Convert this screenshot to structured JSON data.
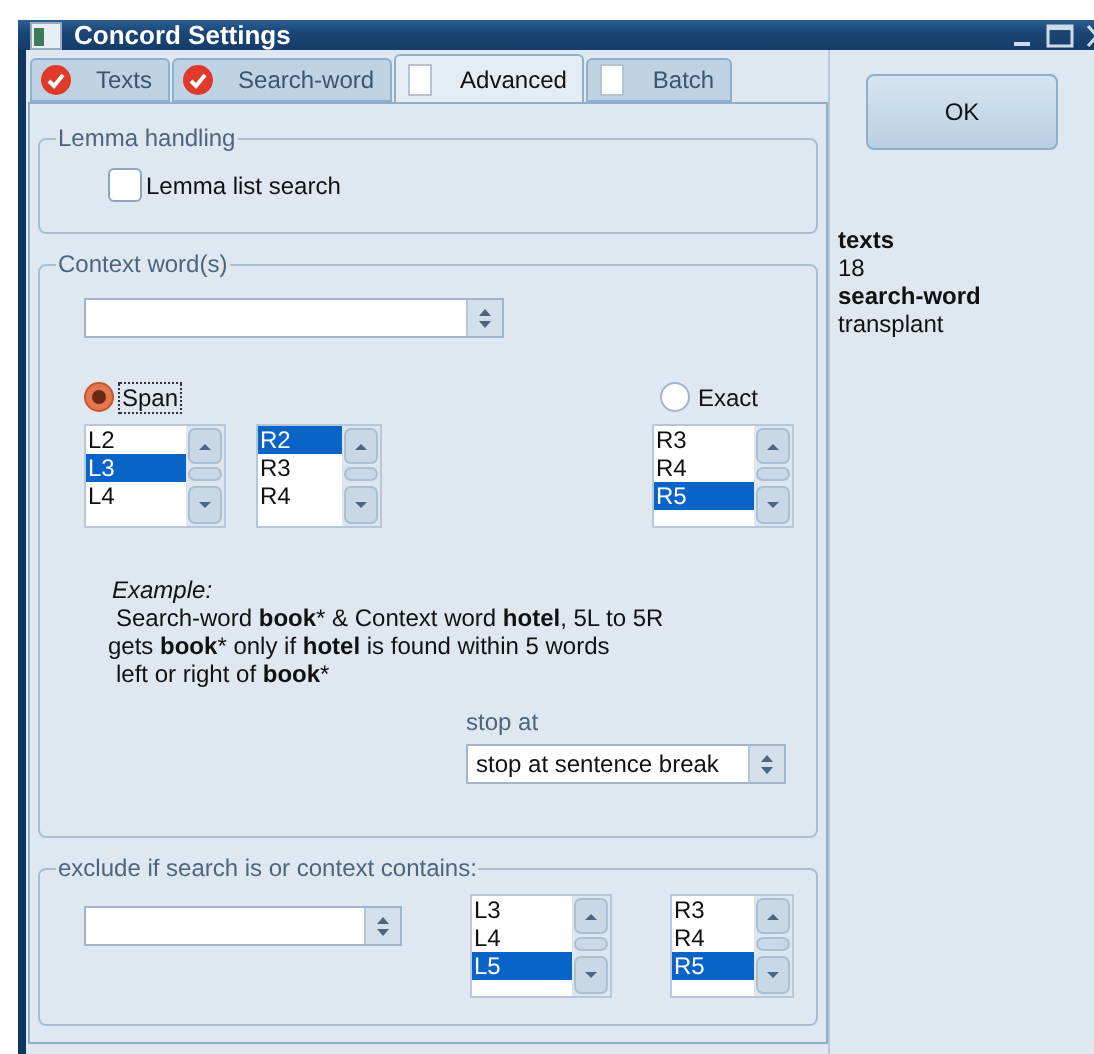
{
  "window": {
    "title": "Concord Settings"
  },
  "tabs": [
    {
      "label": "Texts",
      "checked": true,
      "selected": false
    },
    {
      "label": "Search-word",
      "checked": true,
      "selected": false
    },
    {
      "label": "Advanced",
      "checked": false,
      "selected": true
    },
    {
      "label": "Batch",
      "checked": false,
      "selected": false
    }
  ],
  "lemma": {
    "title": "Lemma handling",
    "checkbox": {
      "label": "Lemma list search",
      "checked": false
    }
  },
  "context": {
    "title": "Context word(s)",
    "modes": [
      {
        "label": "Span",
        "selected": true
      },
      {
        "label": "Exact",
        "selected": false
      }
    ],
    "lists": [
      {
        "items": [
          {
            "label": "L2",
            "selected": false
          },
          {
            "label": "L3",
            "selected": true
          },
          {
            "label": "L4",
            "selected": false
          }
        ]
      },
      {
        "items": [
          {
            "label": "R2",
            "selected": true
          },
          {
            "label": "R3",
            "selected": false
          },
          {
            "label": "R4",
            "selected": false
          }
        ]
      },
      {
        "items": [
          {
            "label": "R3",
            "selected": false
          },
          {
            "label": "R4",
            "selected": false
          },
          {
            "label": "R5",
            "selected": true
          }
        ]
      }
    ],
    "example": {
      "heading": "Example:",
      "lines": [
        "Search-word **book*** & Context word **hotel**, 5L to 5R",
        "gets **book*** only if **hotel** is found within 5 words",
        "left or right of **book***"
      ]
    },
    "stop": {
      "label": "stop at",
      "value": "stop at sentence break"
    }
  },
  "exclude": {
    "title": "exclude if search is or context contains:",
    "lists": [
      {
        "items": [
          {
            "label": "L3",
            "selected": false
          },
          {
            "label": "L4",
            "selected": false
          },
          {
            "label": "L5",
            "selected": true
          }
        ]
      },
      {
        "items": [
          {
            "label": "R3",
            "selected": false
          },
          {
            "label": "R4",
            "selected": false
          },
          {
            "label": "R5",
            "selected": true
          }
        ]
      }
    ]
  },
  "ok": "OK",
  "info": [
    {
      "kind": "label",
      "text": "texts"
    },
    {
      "kind": "value",
      "text": "18"
    },
    {
      "kind": "label",
      "text": "search-word"
    },
    {
      "kind": "value",
      "text": "transplant"
    }
  ]
}
